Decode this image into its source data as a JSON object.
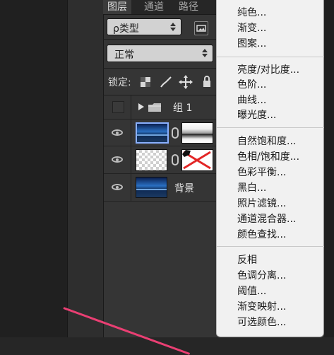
{
  "panel": {
    "tabs": [
      "图层",
      "通道",
      "路径"
    ],
    "kind_filter": "ρ类型",
    "blend_mode": "正常",
    "lock_label": "锁定:",
    "group_name": "组 1",
    "layers": [
      {
        "name": "",
        "thumb": "photo",
        "mask": "white"
      },
      {
        "name": "",
        "thumb": "transparent",
        "mask": "red-x"
      },
      {
        "name": "背景",
        "thumb": "photo",
        "mask": ""
      }
    ]
  },
  "menu": {
    "items": [
      "纯色...",
      "渐变...",
      "图案...",
      "亮度/对比度...",
      "色阶...",
      "曲线...",
      "曝光度...",
      "自然饱和度...",
      "色相/饱和度...",
      "色彩平衡...",
      "黑白...",
      "照片滤镜...",
      "通道混合器...",
      "颜色查找...",
      "反相",
      "色调分离...",
      "阈值...",
      "渐变映射...",
      "可选颜色..."
    ]
  },
  "colors": {
    "panel_bg": "#353535",
    "menu_bg": "#f1f1f1",
    "highlight_line": "#ea3f73"
  },
  "icons": [
    "eye-icon",
    "folder-icon",
    "link-chain-icon",
    "lock-transparent-pixels-icon",
    "paint-brush-icon",
    "move-arrows-icon",
    "padlock-icon"
  ]
}
